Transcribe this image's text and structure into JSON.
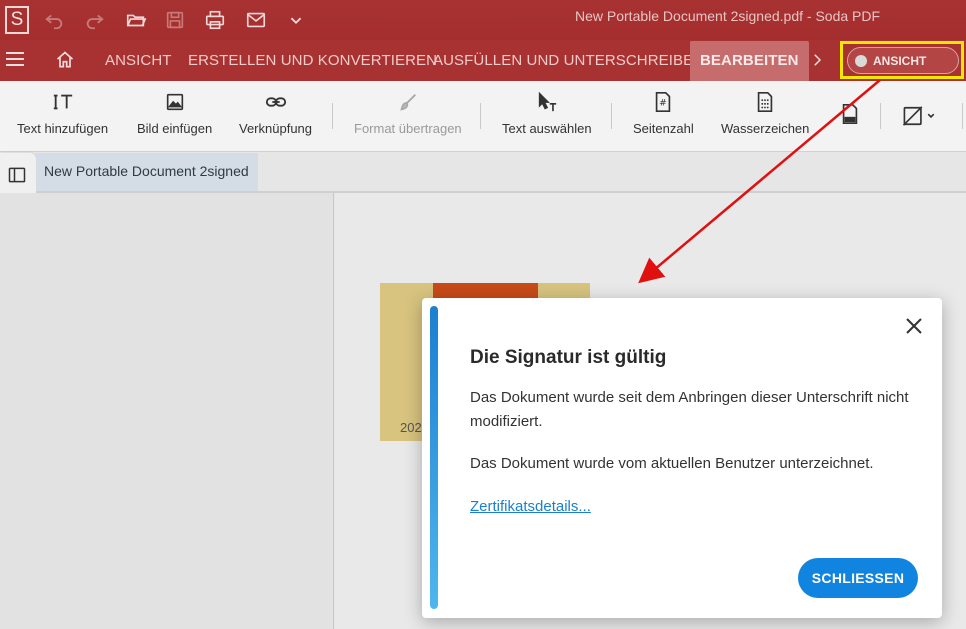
{
  "app": {
    "logo_letter": "S",
    "window_title": "New Portable Document 2signed.pdf   -   Soda PDF"
  },
  "quick_access": [
    "undo-icon",
    "redo-icon",
    "open-folder-icon",
    "save-icon",
    "print-icon",
    "mail-icon",
    "chevron-down-icon"
  ],
  "menu": {
    "items": [
      "ANSICHT",
      "ERSTELLEN UND KONVERTIEREN",
      "AUSFÜLLEN UND UNTERSCHREIBEN",
      "BEARBEITEN"
    ],
    "active": "BEARBEITEN",
    "view_toggle_label": "ANSICHT"
  },
  "toolbar": {
    "add_text": "Text hinzufügen",
    "insert_image": "Bild einfügen",
    "link": "Verknüpfung",
    "format_painter": "Format übertragen",
    "select_text": "Text auswählen",
    "page_number": "Seitenzahl",
    "watermark": "Wasserzeichen"
  },
  "document": {
    "tab_title": "New Portable Document 2signed",
    "page_partial_text": "202"
  },
  "dialog": {
    "title": "Die Signatur ist gültig",
    "message1": "Das Dokument wurde seit dem Anbringen dieser Unterschrift nicht modifiziert.",
    "message2": "Das Dokument wurde vom aktuellen Benutzer unterzeichnet.",
    "link": "Zertifikatsdetails...",
    "close_button": "SCHLIESSEN"
  },
  "colors": {
    "brand_red": "#a83232",
    "accent_blue": "#1184e0",
    "highlight_yellow": "#f2e700",
    "annotation_arrow": "#e01010"
  }
}
